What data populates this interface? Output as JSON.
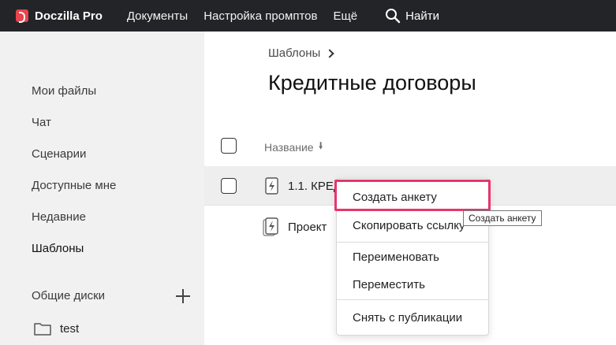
{
  "topbar": {
    "brand": "Doczilla Pro",
    "nav": [
      "Документы",
      "Настройка промптов",
      "Ещё"
    ],
    "search_label": "Найти"
  },
  "sidebar": {
    "items": [
      {
        "label": "Мои файлы"
      },
      {
        "label": "Чат"
      },
      {
        "label": "Сценарии"
      },
      {
        "label": "Доступные мне"
      },
      {
        "label": "Недавние"
      },
      {
        "label": "Шаблоны",
        "active": true
      }
    ],
    "shared_drives_label": "Общие диски",
    "folders": [
      {
        "label": "test"
      }
    ]
  },
  "main": {
    "breadcrumb": "Шаблоны",
    "title": "Кредитные договоры",
    "column_name": "Название",
    "rows": [
      {
        "title": "1.1. КРЕД"
      },
      {
        "title": "Проект"
      }
    ]
  },
  "context_menu": {
    "items": [
      "Создать анкету",
      "Скопировать ссылку",
      "Переименовать",
      "Переместить",
      "Снять с публикации"
    ]
  },
  "tooltip": "Создать анкету",
  "colors": {
    "topbar_bg": "#222428",
    "brand_accent": "#e8434e",
    "highlight": "#e8356b",
    "sidebar_bg": "#f1f1f1"
  }
}
